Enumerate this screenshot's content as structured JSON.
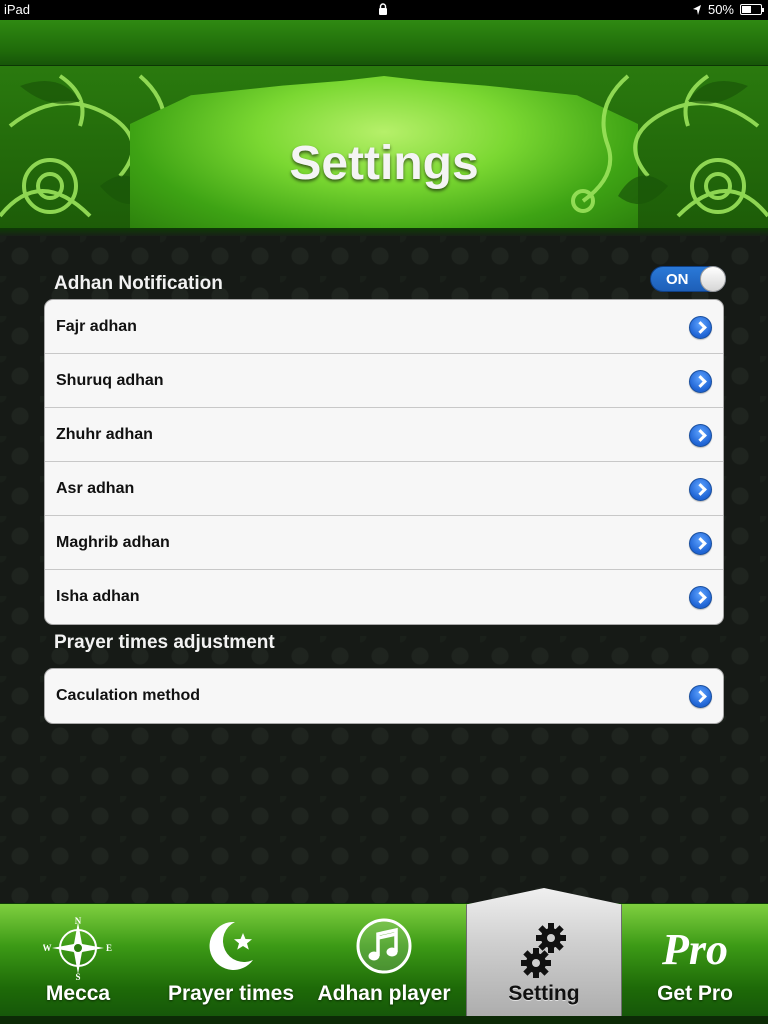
{
  "status_bar": {
    "device": "iPad",
    "battery": "50%",
    "battery_level": 0.5
  },
  "header": {
    "title": "Settings"
  },
  "adhan_notification": {
    "header": "Adhan Notification",
    "toggle_label": "ON",
    "toggle_on": true,
    "items": [
      {
        "label": "Fajr adhan"
      },
      {
        "label": "Shuruq adhan"
      },
      {
        "label": "Zhuhr adhan"
      },
      {
        "label": "Asr adhan"
      },
      {
        "label": "Maghrib adhan"
      },
      {
        "label": "Isha adhan"
      }
    ]
  },
  "prayer_adjustment": {
    "header": "Prayer times adjustment",
    "items": [
      {
        "label": "Caculation method"
      }
    ]
  },
  "tabs": [
    {
      "label": "Mecca",
      "icon": "compass-icon",
      "active": false
    },
    {
      "label": "Prayer times",
      "icon": "crescent-star-icon",
      "active": false
    },
    {
      "label": "Adhan player",
      "icon": "music-note-icon",
      "active": false
    },
    {
      "label": "Setting",
      "icon": "gears-icon",
      "active": true
    },
    {
      "label": "Get Pro",
      "icon": "pro-logo-icon",
      "active": false
    }
  ],
  "tab_extra": {
    "compass_n": "N",
    "compass_s": "S",
    "compass_w": "W",
    "compass_e": "E",
    "pro_logo": "Pro"
  },
  "colors": {
    "accent_green": "#3ea314",
    "toggle_blue": "#2a79d8",
    "disclosure_blue": "#1f64d4"
  }
}
